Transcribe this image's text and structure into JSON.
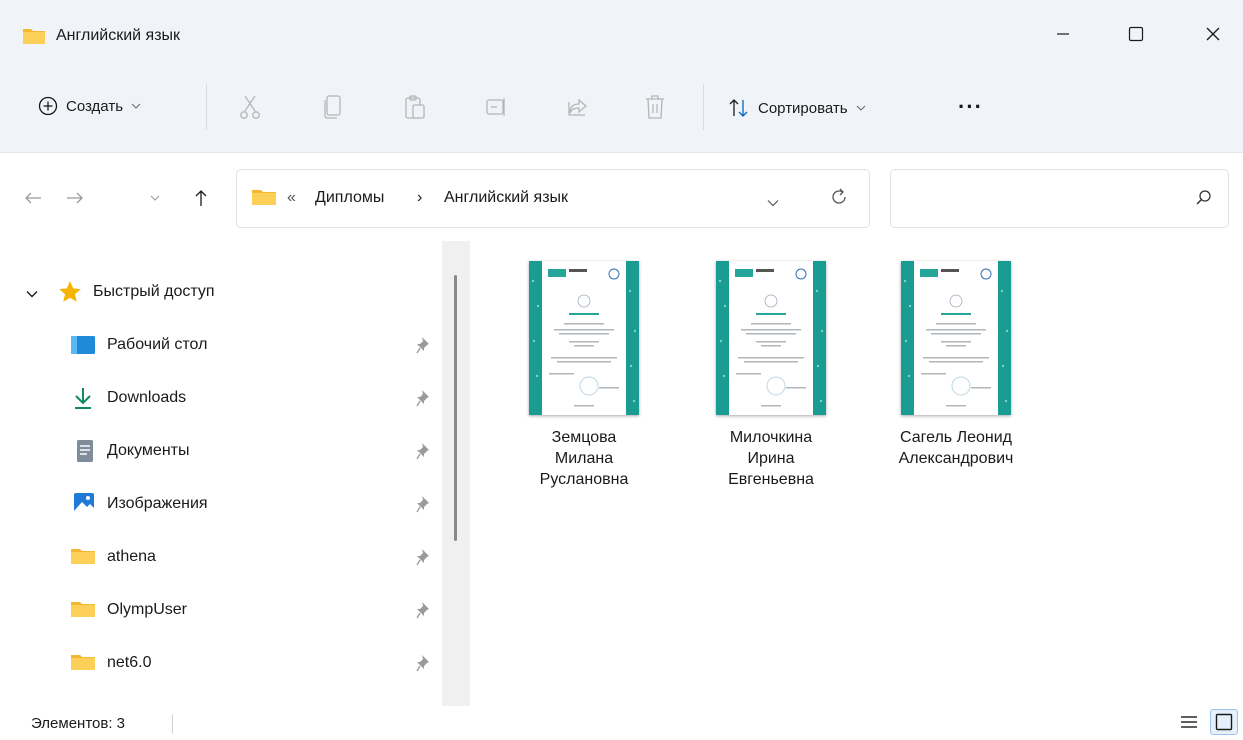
{
  "window": {
    "title": "Английский язык"
  },
  "toolbar": {
    "create_label": "Создать",
    "sort_label": "Сортировать",
    "more_label": "···"
  },
  "address": {
    "overflow": "«",
    "crumbs": [
      "Дипломы",
      "Английский язык"
    ],
    "separator": "›"
  },
  "search": {
    "placeholder": ""
  },
  "sidebar": {
    "quick_access": "Быстрый доступ",
    "items": [
      {
        "label": "Рабочий стол",
        "icon": "desktop-icon"
      },
      {
        "label": "Downloads",
        "icon": "download-icon"
      },
      {
        "label": "Документы",
        "icon": "documents-icon"
      },
      {
        "label": "Изображения",
        "icon": "pictures-icon"
      },
      {
        "label": "athena",
        "icon": "folder-icon"
      },
      {
        "label": "OlympUser",
        "icon": "folder-icon"
      },
      {
        "label": "net6.0",
        "icon": "folder-icon"
      }
    ]
  },
  "files": [
    {
      "line1": "Земцова",
      "line2": "Милана",
      "line3": "Руслановна"
    },
    {
      "line1": "Милочкина",
      "line2": "Ирина",
      "line3": "Евгеньевна"
    },
    {
      "line1": "Сагель Леонид",
      "line2": "Александрович",
      "line3": ""
    }
  ],
  "status": {
    "count": "Элементов: 3"
  },
  "colors": {
    "accent": "#0067c0",
    "folder": "#f8c341",
    "thumb_teal": "#1a9c93",
    "chrome_bg": "#f0f4f9"
  }
}
